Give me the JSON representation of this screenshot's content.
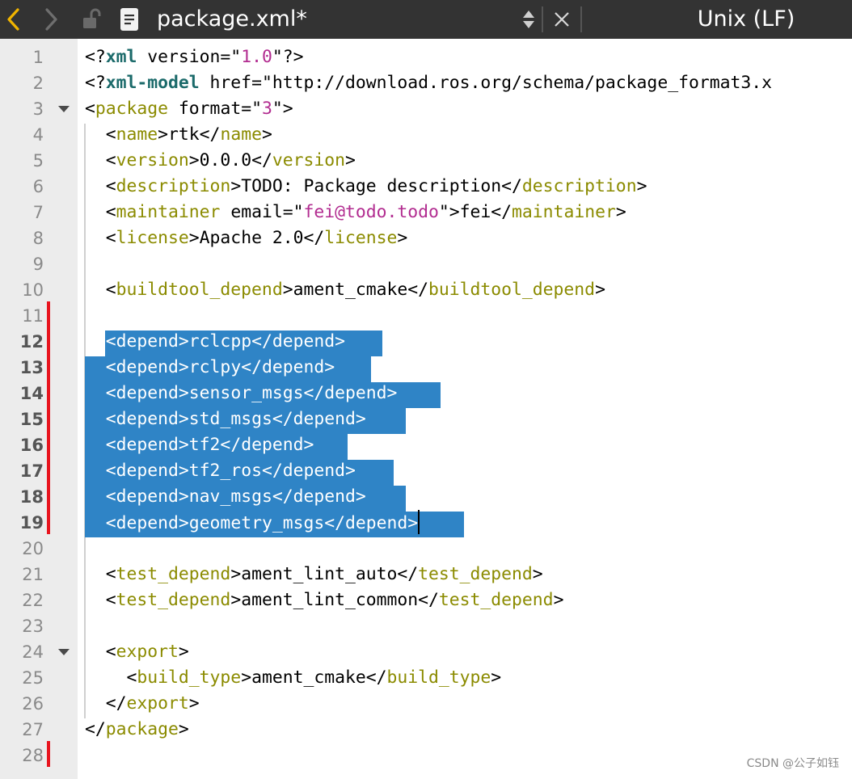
{
  "titlebar": {
    "filename": "package.xml*",
    "line_ending": "Unix (LF)",
    "icons": [
      "chevron-left-icon",
      "chevron-right-icon",
      "lock-open-icon",
      "document-icon",
      "sort-updown-icon",
      "close-icon"
    ]
  },
  "colors": {
    "titlebar_bg": "#333333",
    "back_arrow": "#f0b400",
    "tag": "#8b8b00",
    "keyword": "#1b6a6a",
    "string": "#b22c90",
    "selection": "#2f84c6",
    "change_marker": "#e8141e"
  },
  "editor": {
    "line_numbers": [
      "1",
      "2",
      "3",
      "4",
      "5",
      "6",
      "7",
      "8",
      "9",
      "10",
      "11",
      "12",
      "13",
      "14",
      "15",
      "16",
      "17",
      "18",
      "19",
      "20",
      "21",
      "22",
      "23",
      "24",
      "25",
      "26",
      "27",
      "28"
    ],
    "lines": [
      "<?xml version=\"1.0\"?>",
      "<?xml-model href=\"http://download.ros.org/schema/package_format3.x",
      "<package format=\"3\">",
      "  <name>rtk</name>",
      "  <version>0.0.0</version>",
      "  <description>TODO: Package description</description>",
      "  <maintainer email=\"fei@todo.todo\">fei</maintainer>",
      "  <license>Apache 2.0</license>",
      "",
      "  <buildtool_depend>ament_cmake</buildtool_depend>",
      "",
      "  <depend>rclcpp</depend>",
      "  <depend>rclpy</depend>",
      "  <depend>sensor_msgs</depend>",
      "  <depend>std_msgs</depend>",
      "  <depend>tf2</depend>",
      "  <depend>tf2_ros</depend>",
      "  <depend>nav_msgs</depend>",
      "  <depend>geometry_msgs</depend>",
      "",
      "  <test_depend>ament_lint_auto</test_depend>",
      "  <test_depend>ament_lint_common</test_depend>",
      "",
      "  <export>",
      "    <build_type>ament_cmake</build_type>",
      "  </export>",
      "</package>",
      ""
    ],
    "selected_lines": [
      12,
      13,
      14,
      15,
      16,
      17,
      18,
      19
    ],
    "bold_line_numbers": [
      12,
      13,
      14,
      15,
      16,
      17,
      18,
      19
    ],
    "fold_lines": [
      3,
      24
    ]
  },
  "watermark": "CSDN @公子如钰"
}
